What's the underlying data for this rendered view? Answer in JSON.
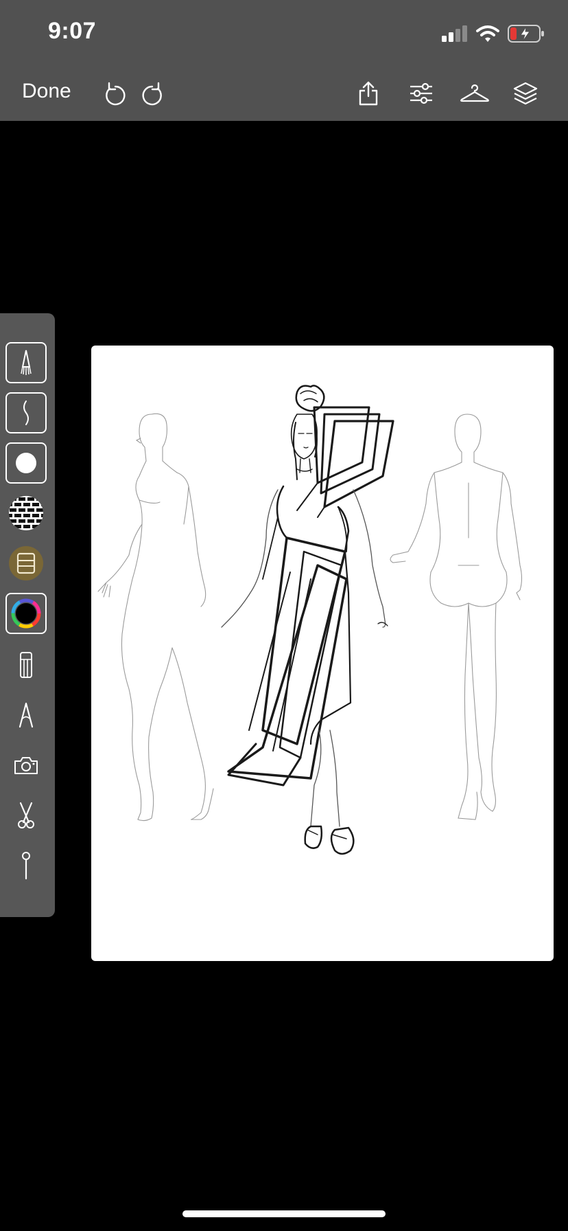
{
  "status_bar": {
    "time": "9:07",
    "icons": [
      "cellular-signal-icon",
      "wifi-icon",
      "battery-charging-icon"
    ],
    "battery_color": "#e53935"
  },
  "toolbar": {
    "done_label": "Done",
    "left_icons": [
      "undo-icon",
      "redo-icon"
    ],
    "right_icons": [
      "share-icon",
      "adjustments-icon",
      "hanger-icon",
      "layers-icon"
    ],
    "background": "#515151"
  },
  "tool_palette": {
    "tools": [
      "pen-nib-icon",
      "pencil-stroke-icon",
      "brush-size-icon",
      "pattern-swatch-icon",
      "fabric-swatch-icon",
      "color-wheel-icon",
      "ruler-icon",
      "compass-icon",
      "camera-icon",
      "scissors-icon",
      "pin-icon"
    ],
    "selected": [
      "pen-nib-icon",
      "pencil-stroke-icon",
      "brush-size-icon",
      "color-wheel-icon"
    ],
    "background": "#575757"
  },
  "canvas": {
    "background": "#ffffff",
    "content": [
      "left-croquis-figure",
      "center-dress-sketch",
      "right-croquis-figure"
    ]
  }
}
